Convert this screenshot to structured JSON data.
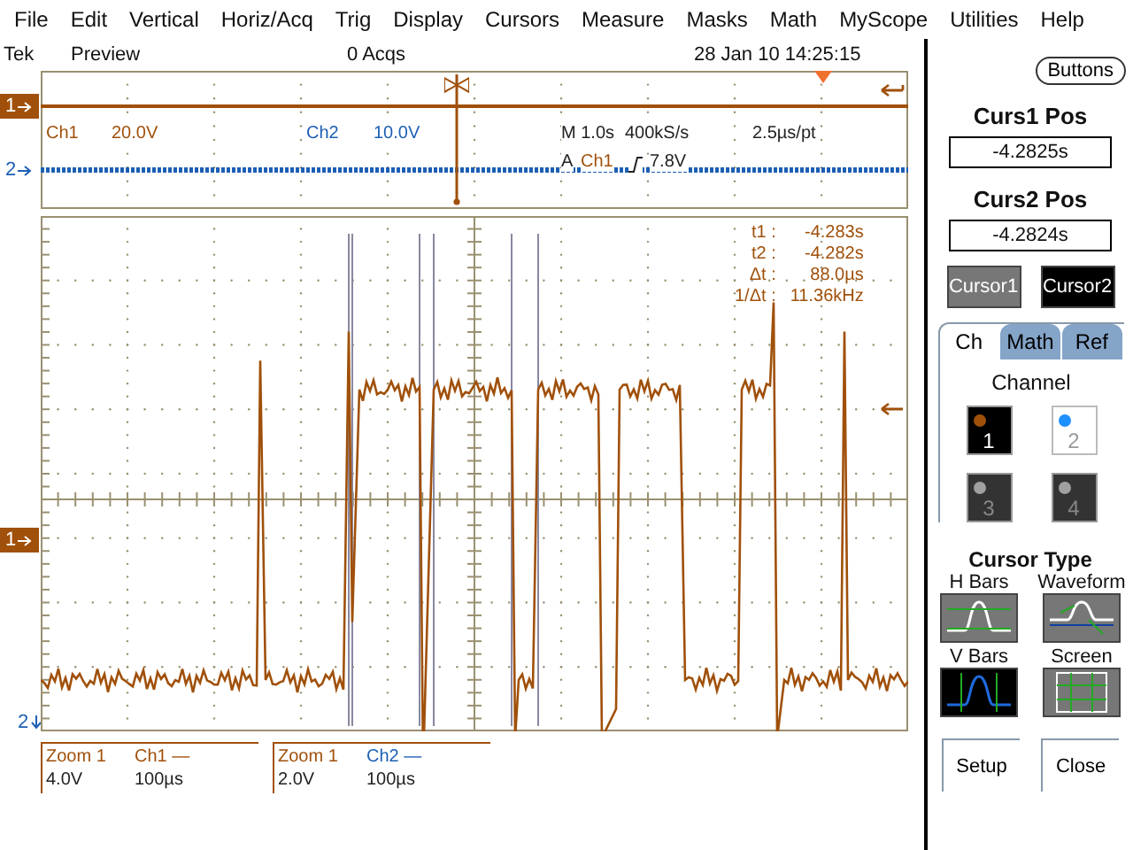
{
  "menu": [
    "File",
    "Edit",
    "Vertical",
    "Horiz/Acq",
    "Trig",
    "Display",
    "Cursors",
    "Measure",
    "Masks",
    "Math",
    "MyScope",
    "Utilities",
    "Help"
  ],
  "status": {
    "brand": "Tek",
    "mode": "Preview",
    "acquisitions": "0 Acqs",
    "datetime": "28 Jan 10 14:25:15"
  },
  "overview": {
    "ch1_marker": "1",
    "ch2_marker": "2",
    "ch1_label": "Ch1",
    "ch1_scale": "20.0V",
    "ch2_label": "Ch2",
    "ch2_scale": "10.0V",
    "timebase": "M 1.0s",
    "sample_rate": "400kS/s",
    "resolution": "2.5µs/pt",
    "trigger_source_prefix": "A",
    "trigger_channel": "Ch1",
    "trigger_level": "7.8V"
  },
  "main": {
    "ch1_marker": "1",
    "ch2_marker": "2",
    "cursor_readout": [
      {
        "label": "t1 :",
        "value": "-4.283s"
      },
      {
        "label": "t2 :",
        "value": "-4.282s"
      },
      {
        "label": "Δt :",
        "value": "88.0µs"
      },
      {
        "label": "1/Δt :",
        "value": "11.36kHz"
      }
    ]
  },
  "zoom_readouts": [
    {
      "title": "Zoom 1",
      "channel": "Ch1 —",
      "color": "#a0500a",
      "volts": "4.0V",
      "time": "100µs"
    },
    {
      "title": "Zoom 1",
      "channel": "Ch2 —",
      "color": "#1c5fb4",
      "volts": "2.0V",
      "time": "100µs"
    }
  ],
  "panel": {
    "buttons_label": "Buttons",
    "positions": [
      {
        "label": "Curs1 Pos",
        "value": "-4.2825s"
      },
      {
        "label": "Curs2 Pos",
        "value": "-4.2824s"
      }
    ],
    "cursor_buttons": [
      {
        "label": "Cursor1",
        "selected": false
      },
      {
        "label": "Cursor2",
        "selected": true
      }
    ],
    "tabs": [
      {
        "label": "Ch",
        "selected": true
      },
      {
        "label": "Math",
        "selected": false
      },
      {
        "label": "Ref",
        "selected": false
      }
    ],
    "channel_title": "Channel",
    "channels": [
      {
        "label": "1",
        "selected": true,
        "on": true,
        "color": "#a0500a"
      },
      {
        "label": "2",
        "selected": false,
        "on": true,
        "color": "#1e90ff"
      },
      {
        "label": "3",
        "selected": false,
        "on": false,
        "color": "#a0a0a0"
      },
      {
        "label": "4",
        "selected": false,
        "on": false,
        "color": "#a0a0a0"
      }
    ],
    "cursor_type_title": "Cursor Type",
    "cursor_types": [
      {
        "label": "H Bars",
        "kind": "hbars",
        "selected": false
      },
      {
        "label": "Waveform",
        "kind": "waveform",
        "selected": false
      },
      {
        "label": "V Bars",
        "kind": "vbars",
        "selected": true
      },
      {
        "label": "Screen",
        "kind": "screen",
        "selected": false
      }
    ],
    "footer_buttons": [
      "Setup",
      "Close"
    ]
  }
}
